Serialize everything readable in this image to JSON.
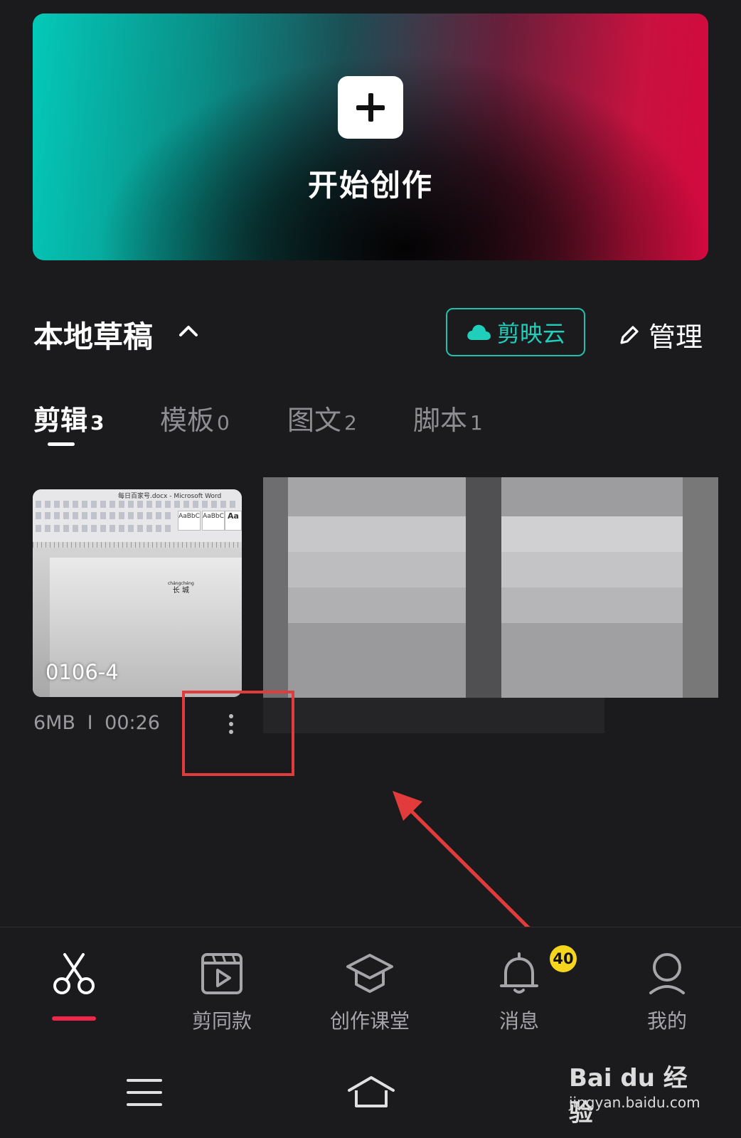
{
  "hero": {
    "title": "开始创作",
    "icon": "plus-icon"
  },
  "drafts": {
    "title": "本地草稿",
    "cloud_button": "剪映云",
    "manage_label": "管理"
  },
  "tabs": [
    {
      "label": "剪辑",
      "count": "3",
      "active": true
    },
    {
      "label": "模板",
      "count": "0",
      "active": false
    },
    {
      "label": "图文",
      "count": "2",
      "active": false
    },
    {
      "label": "脚本",
      "count": "1",
      "active": false
    }
  ],
  "project": {
    "name": "0106-4",
    "size": "6MB",
    "separator": "I",
    "duration": "00:26",
    "thumbnail": {
      "doc_title": "每日百家号.docx - Microsoft Word",
      "styles": [
        "AaBbC",
        "AaBbC",
        "Aa"
      ],
      "pinyin": "chángchéng",
      "text": "长 城"
    }
  },
  "bottom_nav": [
    {
      "label": "",
      "icon": "scissors-icon",
      "active": true
    },
    {
      "label": "剪同款",
      "icon": "template-clip-icon",
      "active": false
    },
    {
      "label": "创作课堂",
      "icon": "graduation-cap-icon",
      "active": false
    },
    {
      "label": "消息",
      "icon": "bell-icon",
      "active": false,
      "badge": "40"
    },
    {
      "label": "我的",
      "icon": "user-icon",
      "active": false
    }
  ],
  "watermark": {
    "brand": "Bai du 经验",
    "url": "jingyan.baidu.com"
  },
  "colors": {
    "accent_red": "#f5244a",
    "cloud_teal": "#1fbfae",
    "badge_yellow": "#f6d51d",
    "annotation_red": "#e23b3b"
  }
}
